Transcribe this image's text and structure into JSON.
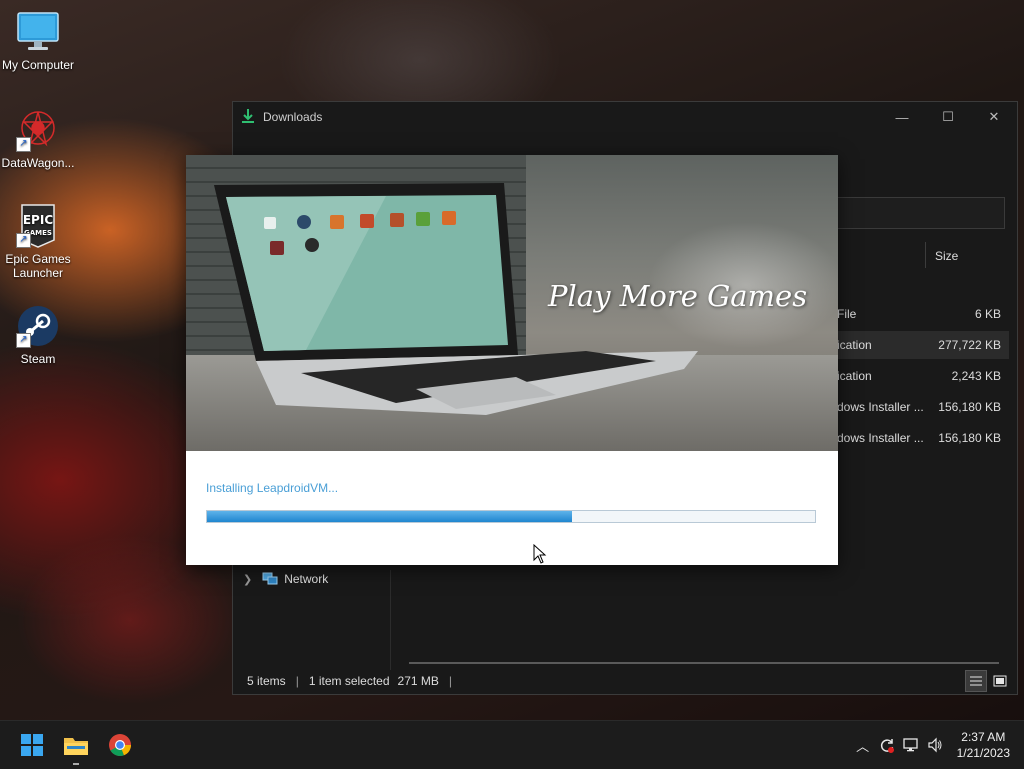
{
  "desktop": {
    "icons": [
      {
        "label": "My Computer"
      },
      {
        "label": "DataWagon..."
      },
      {
        "label": "Epic Games Launcher"
      },
      {
        "label": "Steam"
      }
    ]
  },
  "explorer": {
    "title": "Downloads",
    "window_controls": {
      "minimize": "—",
      "maximize": "☐",
      "close": "✕"
    },
    "columns": {
      "size": "Size"
    },
    "files": [
      {
        "type": "File",
        "size": "6 KB",
        "selected": false
      },
      {
        "type": "ication",
        "size": "277,722 KB",
        "selected": true
      },
      {
        "type": "ication",
        "size": "2,243 KB",
        "selected": false
      },
      {
        "type": "dows Installer ...",
        "size": "156,180 KB",
        "selected": false
      },
      {
        "type": "dows Installer ...",
        "size": "156,180 KB",
        "selected": false
      }
    ],
    "nav": {
      "network": "Network"
    },
    "status": {
      "items": "5 items",
      "selected": "1 item selected",
      "size": "271 MB"
    }
  },
  "installer": {
    "banner_title": "Play More Games",
    "status_text": "Installing LeapdroidVM...",
    "progress": 0.6
  },
  "taskbar": {
    "apps": [
      {
        "icon": "windows-start-icon"
      },
      {
        "icon": "file-explorer-icon"
      },
      {
        "icon": "chrome-icon"
      }
    ],
    "tray": {
      "time": "2:37 AM",
      "date": "1/21/2023"
    }
  }
}
